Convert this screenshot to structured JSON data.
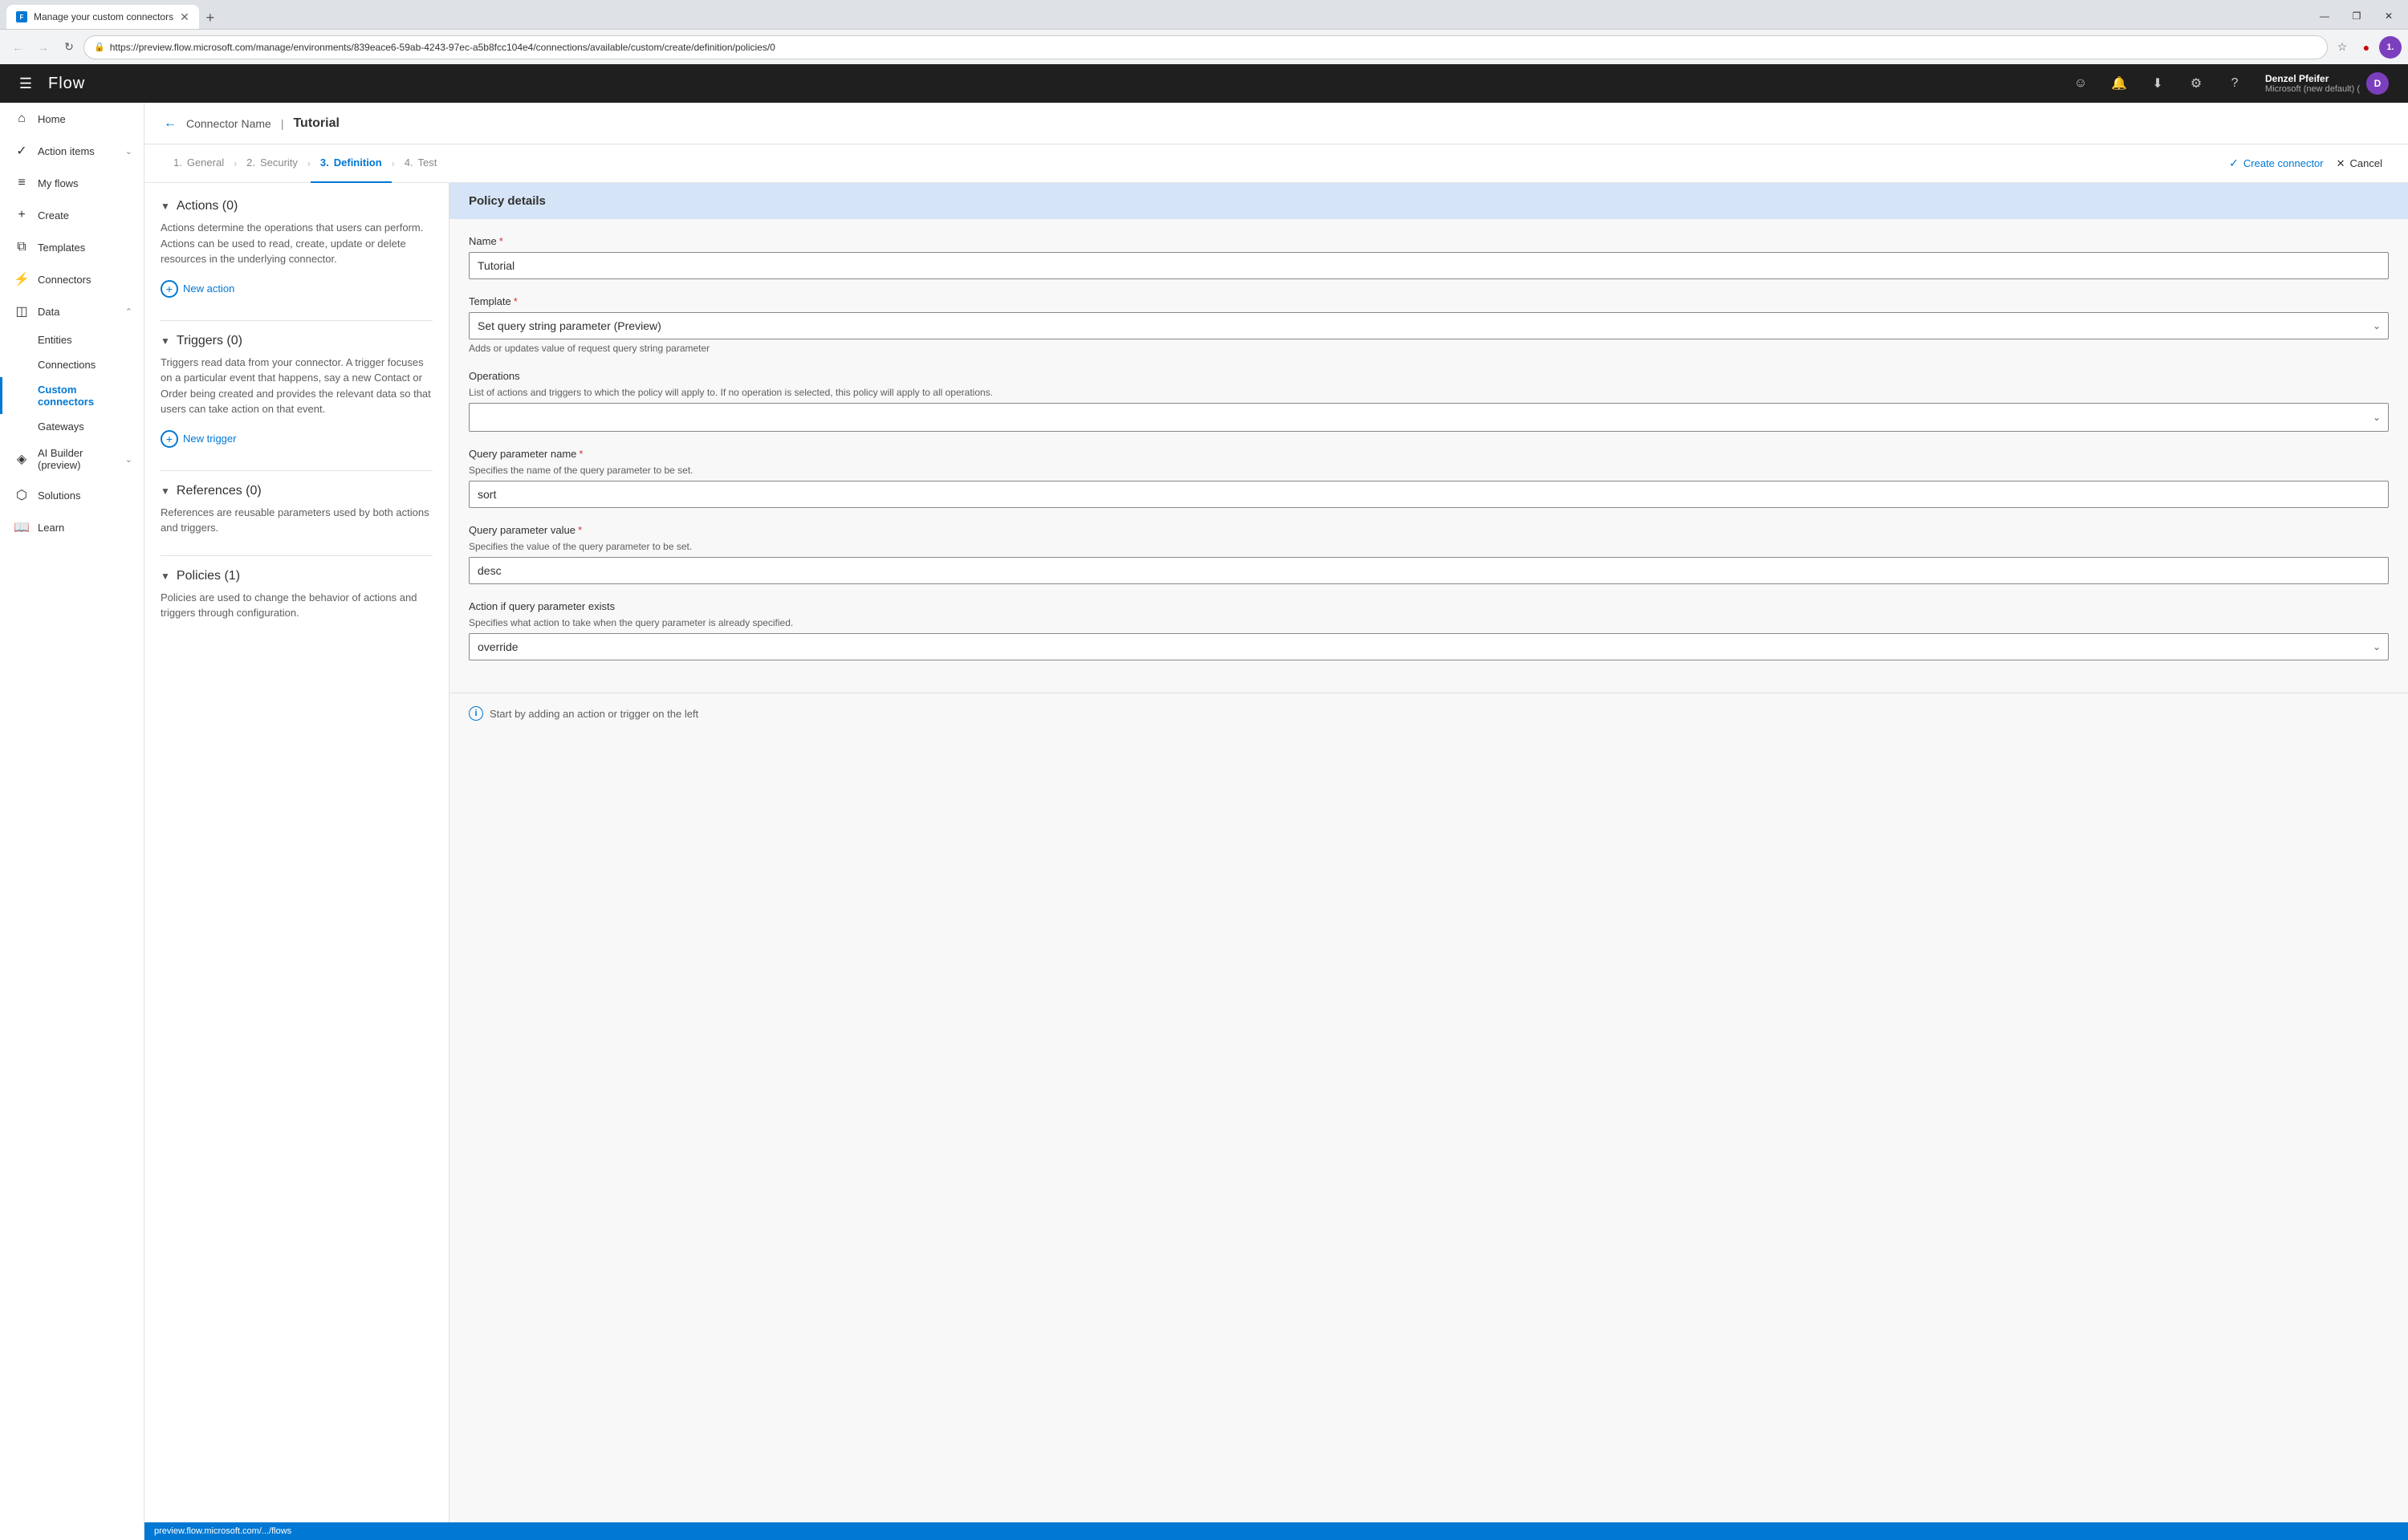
{
  "browser": {
    "tab_title": "Manage your custom connectors",
    "tab_favicon": "F",
    "url": "https://preview.flow.microsoft.com/manage/environments/839eace6-59ab-4243-97ec-a5b8fcc104e4/connections/available/custom/create/definition/policies/0",
    "nav_back_disabled": false,
    "nav_forward_disabled": true
  },
  "window_controls": {
    "minimize": "—",
    "maximize": "❐",
    "close": "✕"
  },
  "topbar": {
    "app_name": "Flow",
    "user_name": "Denzel Pfeifer",
    "user_org": "Microsoft (new default) (",
    "user_initial": "D",
    "icons": {
      "emoji": "☺",
      "bell": "🔔",
      "download": "⬇",
      "settings": "⚙",
      "help": "?"
    }
  },
  "sidebar": {
    "items": [
      {
        "id": "home",
        "label": "Home",
        "icon": "⌂",
        "active": false
      },
      {
        "id": "action-items",
        "label": "Action items",
        "icon": "✓",
        "active": false,
        "has_chevron": true
      },
      {
        "id": "my-flows",
        "label": "My flows",
        "icon": "≡",
        "active": false
      },
      {
        "id": "create",
        "label": "Create",
        "icon": "+",
        "active": false
      },
      {
        "id": "templates",
        "label": "Templates",
        "icon": "⧉",
        "active": false
      },
      {
        "id": "connectors",
        "label": "Connectors",
        "icon": "⚡",
        "active": false
      },
      {
        "id": "data",
        "label": "Data",
        "icon": "◫",
        "active": false,
        "has_chevron": true,
        "expanded": true
      }
    ],
    "sub_items": [
      {
        "id": "entities",
        "label": "Entities",
        "active": false
      },
      {
        "id": "connections",
        "label": "Connections",
        "active": false
      },
      {
        "id": "custom-connectors",
        "label": "Custom connectors",
        "active": true
      },
      {
        "id": "gateways",
        "label": "Gateways",
        "active": false
      }
    ],
    "bottom_items": [
      {
        "id": "ai-builder",
        "label": "AI Builder (preview)",
        "icon": "◈",
        "active": false,
        "has_chevron": true
      },
      {
        "id": "solutions",
        "label": "Solutions",
        "icon": "⬡",
        "active": false
      },
      {
        "id": "learn",
        "label": "Learn",
        "icon": "📖",
        "active": false
      }
    ]
  },
  "page_header": {
    "back_button": "←",
    "connector_name": "Connector Name",
    "separator": "|",
    "current_page": "Tutorial"
  },
  "wizard": {
    "steps": [
      {
        "id": "general",
        "number": "1.",
        "label": "General",
        "active": false
      },
      {
        "id": "security",
        "number": "2.",
        "label": "Security",
        "active": false
      },
      {
        "id": "definition",
        "number": "3.",
        "label": "Definition",
        "active": true
      },
      {
        "id": "test",
        "number": "4.",
        "label": "Test",
        "active": false
      }
    ],
    "create_connector_label": "Create connector",
    "cancel_label": "Cancel",
    "check_icon": "✓",
    "close_icon": "✕"
  },
  "left_panel": {
    "sections": [
      {
        "id": "actions",
        "title": "Actions (0)",
        "body": "Actions determine the operations that users can perform. Actions can be used to read, create, update or delete resources in the underlying connector.",
        "button_label": "New action"
      },
      {
        "id": "triggers",
        "title": "Triggers (0)",
        "body": "Triggers read data from your connector. A trigger focuses on a particular event that happens, say a new Contact or Order being created and provides the relevant data so that users can take action on that event.",
        "button_label": "New trigger"
      },
      {
        "id": "references",
        "title": "References (0)",
        "body": "References are reusable parameters used by both actions and triggers.",
        "button_label": null
      },
      {
        "id": "policies",
        "title": "Policies (1)",
        "body": "Policies are used to change the behavior of actions and triggers through configuration.",
        "button_label": null
      }
    ]
  },
  "right_panel": {
    "header": "Policy details",
    "fields": [
      {
        "id": "name",
        "label": "Name",
        "required": true,
        "type": "input",
        "value": "Tutorial",
        "hint": null
      },
      {
        "id": "template",
        "label": "Template",
        "required": true,
        "type": "select",
        "value": "Set query string parameter (Preview)",
        "hint": "Adds or updates value of request query string parameter"
      },
      {
        "id": "operations",
        "label": "Operations",
        "required": false,
        "type": "dropdown",
        "value": "",
        "hint": "List of actions and triggers to which the policy will apply to. If no operation is selected, this policy will apply to all operations."
      },
      {
        "id": "query-param-name",
        "label": "Query parameter name",
        "required": true,
        "type": "input",
        "value": "sort",
        "hint": "Specifies the name of the query parameter to be set."
      },
      {
        "id": "query-param-value",
        "label": "Query parameter value",
        "required": true,
        "type": "input",
        "value": "desc",
        "hint": "Specifies the value of the query parameter to be set."
      },
      {
        "id": "action-if-exists",
        "label": "Action if query parameter exists",
        "required": false,
        "type": "select",
        "value": "override",
        "hint": "Specifies what action to take when the query parameter is already specified."
      }
    ],
    "bottom_hint": "Start by adding an action or trigger on the left"
  },
  "status_bar": {
    "url": "preview.flow.microsoft.com/.../flows"
  }
}
